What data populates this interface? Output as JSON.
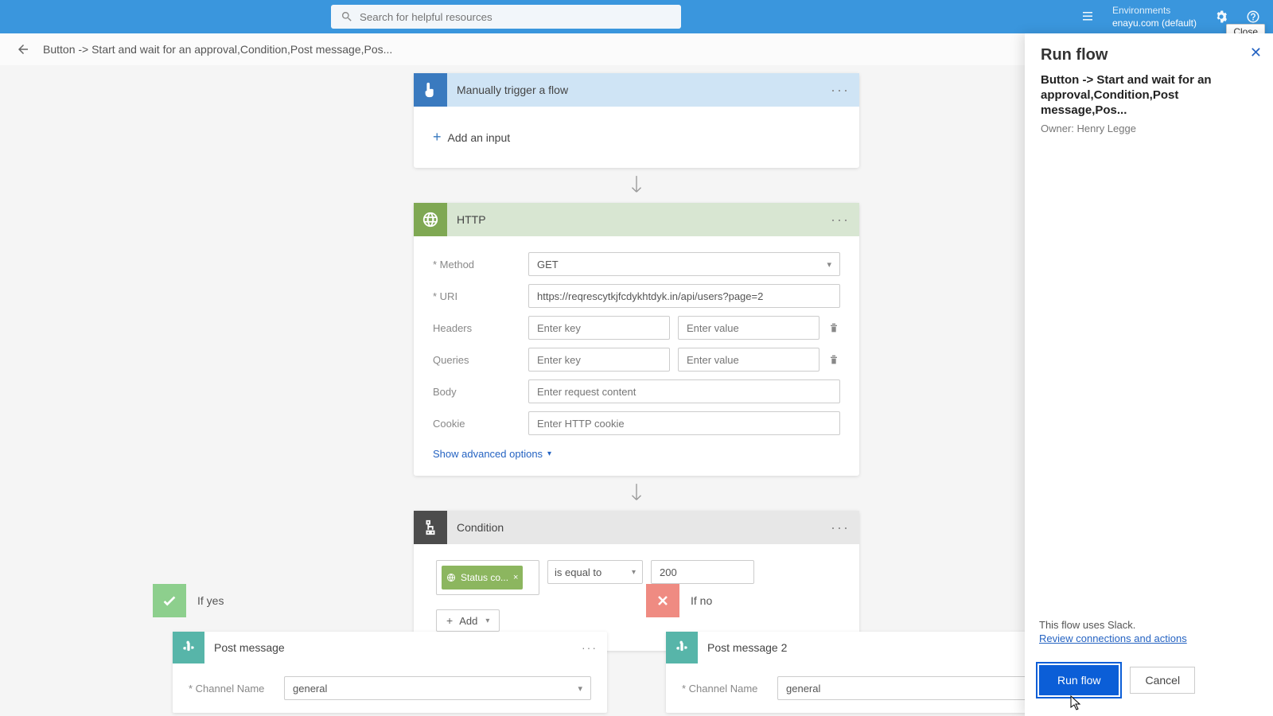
{
  "header": {
    "search_placeholder": "Search for helpful resources",
    "env_label": "Environments",
    "env_value": "enayu.com (default)",
    "close_tooltip": "Close"
  },
  "breadcrumb": "Button -> Start and wait for an approval,Condition,Post message,Pos...",
  "trigger": {
    "title": "Manually trigger a flow",
    "add_input": "Add an input"
  },
  "http": {
    "title": "HTTP",
    "method_label": "Method",
    "method_value": "GET",
    "uri_label": "URI",
    "uri_value": "https://reqrescytkjfcdykhtdyk.in/api/users?page=2",
    "headers_label": "Headers",
    "queries_label": "Queries",
    "body_label": "Body",
    "cookie_label": "Cookie",
    "key_placeholder": "Enter key",
    "value_placeholder": "Enter value",
    "body_placeholder": "Enter request content",
    "cookie_placeholder": "Enter HTTP cookie",
    "advanced": "Show advanced options"
  },
  "condition": {
    "title": "Condition",
    "token": "Status co...",
    "operator": "is equal to",
    "value": "200",
    "add": "Add"
  },
  "branches": {
    "yes_label": "If yes",
    "no_label": "If no",
    "yes_card_title": "Post message",
    "no_card_title": "Post message 2",
    "channel_label": "Channel Name",
    "channel_value": "general"
  },
  "panel": {
    "title": "Run flow",
    "subtitle": "Button -> Start and wait for an approval,Condition,Post message,Pos...",
    "owner": "Owner: Henry Legge",
    "uses": "This flow uses Slack.",
    "review": "Review connections and actions",
    "run": "Run flow",
    "cancel": "Cancel"
  }
}
